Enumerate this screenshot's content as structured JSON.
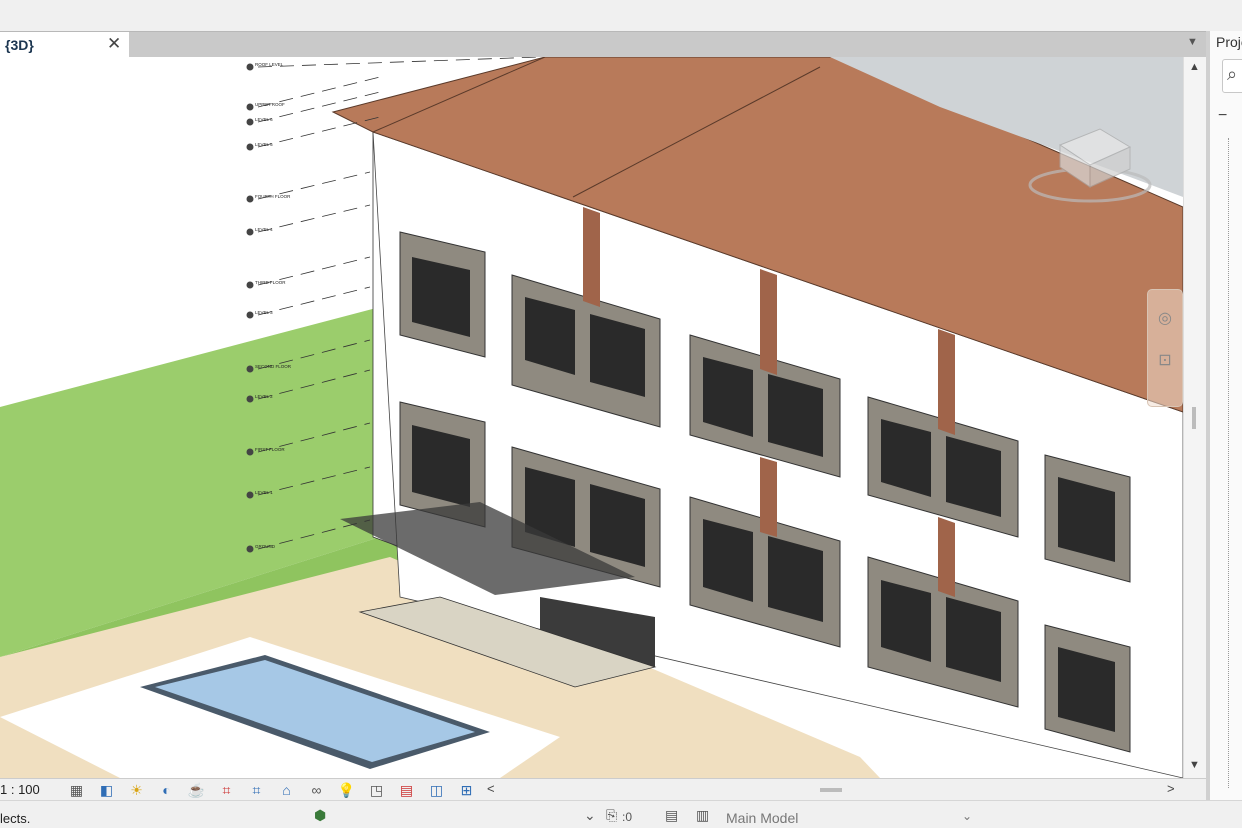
{
  "window": {
    "tab_title": "{3D}",
    "close_glyph": "✕",
    "tab_menu_glyph": "▼"
  },
  "panel": {
    "title": "Proje",
    "search_glyph": "⌕",
    "collapse_glyph": "−"
  },
  "level_tags": [
    "ROOF LEVEL",
    "UPPER ROOF",
    "LEVEL 6",
    "LEVEL 5",
    "FOURTH FLOOR",
    "LEVEL 4",
    "THIRD FLOOR",
    "LEVEL 3",
    "SECOND FLOOR",
    "LEVEL 2",
    "FIRST FLOOR",
    "LEVEL 1",
    "GROUND"
  ],
  "viewbar": {
    "scale": "1 : 100",
    "icons": [
      "detail-level-icon",
      "visual-style-icon",
      "sun-path-icon",
      "shadows-icon",
      "render-icon",
      "crop-view-icon",
      "show-crop-icon",
      "unlock-3d-icon",
      "temporary-hide-icon",
      "reveal-hidden-icon",
      "analysis-icon",
      "highlight-icon",
      "constraints-icon",
      "worksharing-icon"
    ],
    "scroll_left": "<",
    "scroll_right": ">"
  },
  "status": {
    "text": "lects.",
    "editing_count": ":0",
    "workset": "Main Model",
    "workset_arrow": "⌄"
  },
  "colors": {
    "roof": "#b87a5a",
    "grass": "#9bcd6c",
    "facade_panel": "#8f8a80",
    "pool_water": "#a6c8e6",
    "paving": "#f0dfc0"
  }
}
